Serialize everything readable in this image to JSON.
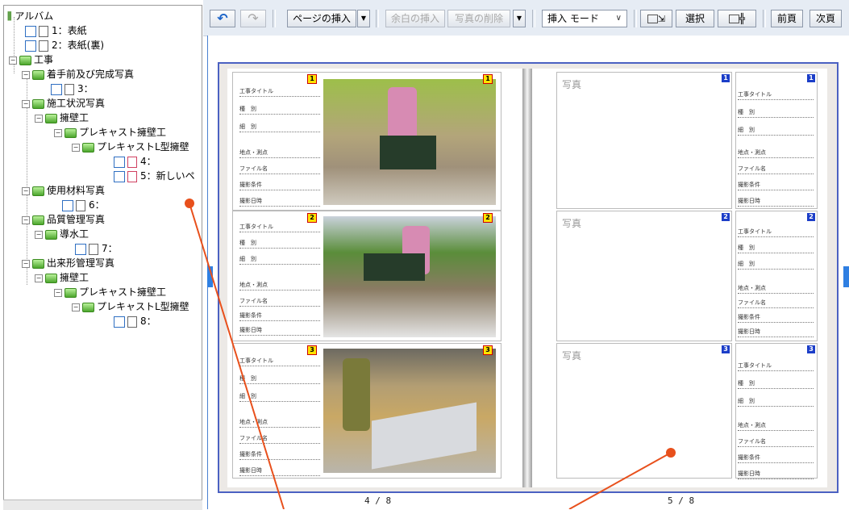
{
  "tree": {
    "root": "アルバム",
    "nodes": [
      "1：表紙",
      "2：表紙(裏)",
      "工事",
      "着手前及び完成写真",
      "3：",
      "施工状況写真",
      "擁壁工",
      "プレキャスト擁壁工",
      "プレキャストL型擁壁",
      "4：",
      "5：新しいペ",
      "使用材料写真",
      "6：",
      "品質管理写真",
      "導水工",
      "7：",
      "出来形管理写真",
      "擁壁工",
      "プレキャスト擁壁工",
      "プレキャストL型擁壁",
      "8："
    ]
  },
  "toolbar": {
    "undo": "↶",
    "redo": "↷",
    "insert_page": "ページの挿入",
    "insert_blank": "余白の挿入",
    "delete_photo": "写真の削除",
    "insert_mode": "挿入 モード",
    "select": "選択",
    "prev_page": "前頁",
    "next_page": "次頁"
  },
  "left_page": {
    "number": "4 / 8",
    "slots": [
      "1",
      "2",
      "3"
    ],
    "labels": [
      "工事タイトル",
      "種　別",
      "細　別",
      "地点・測点",
      "ファイル名",
      "撮影条件",
      "撮影日時"
    ]
  },
  "right_page": {
    "number": "5 / 8",
    "photo_label": "写真",
    "slots": [
      "1",
      "2",
      "3"
    ]
  },
  "colors": {
    "accent": "#4b61c2",
    "arrow": "#e8501c",
    "folder": "#4ca62c"
  }
}
